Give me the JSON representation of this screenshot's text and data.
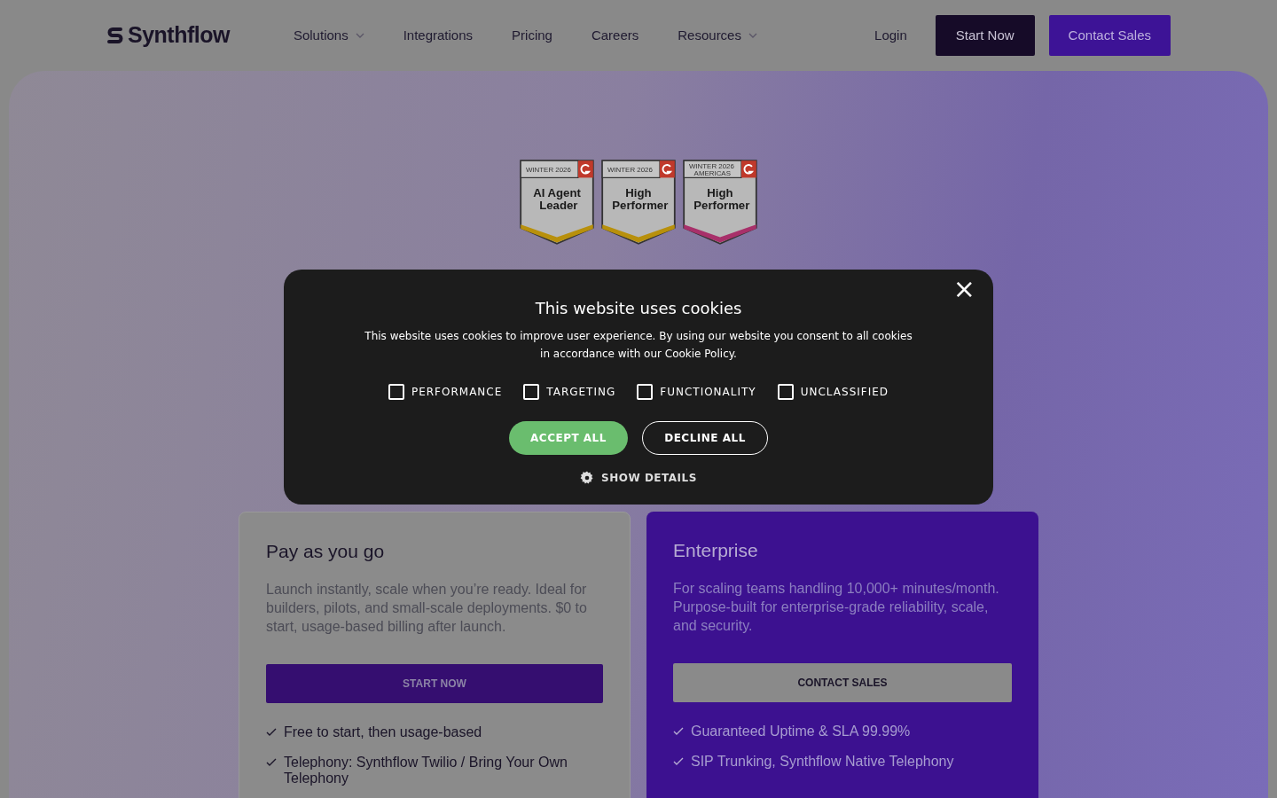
{
  "nav": {
    "logo": "Synthflow",
    "links": [
      {
        "label": "Solutions",
        "dropdown": true
      },
      {
        "label": "Integrations",
        "dropdown": false
      },
      {
        "label": "Pricing",
        "dropdown": false
      },
      {
        "label": "Careers",
        "dropdown": false
      },
      {
        "label": "Resources",
        "dropdown": true
      }
    ],
    "login": "Login",
    "start": "Start Now",
    "contact": "Contact Sales"
  },
  "badges": [
    {
      "season": "WINTER 2026",
      "title": "AI Agent Leader",
      "color": "#b8900c"
    },
    {
      "season": "WINTER 2026",
      "title": "High Performer",
      "color": "#b8900c"
    },
    {
      "season": "WINTER 2026 AMERICAS",
      "title": "High Performer",
      "color": "#a8306a"
    }
  ],
  "cookie_banner": {
    "title": "This website uses cookies",
    "text": "This website uses cookies to improve user experience. By using our website you consent to all cookies in accordance with our Cookie Policy.",
    "close": "×",
    "options": [
      {
        "label": "PERFORMANCE",
        "checked": false
      },
      {
        "label": "TARGETING",
        "checked": false
      },
      {
        "label": "FUNCTIONALITY",
        "checked": false
      },
      {
        "label": "UNCLASSIFIED",
        "checked": false
      }
    ],
    "accept": "ACCEPT ALL",
    "decline": "DECLINE ALL",
    "details": "SHOW DETAILS"
  },
  "plans": [
    {
      "kind": "light",
      "title": "Pay as you go",
      "description": "Launch instantly, scale when you’re ready. Ideal for builders, pilots, and small-scale deployments. $0 to start, usage-based billing after launch.",
      "button": "START NOW",
      "features": [
        "Free to start, then usage-based",
        "Telephony: Synthflow Twilio / Bring Your Own Telephony"
      ]
    },
    {
      "kind": "dark",
      "title": "Enterprise",
      "description": "For scaling teams handling 10,000+ minutes/month. Purpose-built for enterprise-grade reliability, scale, and security.",
      "button": "CONTACT SALES",
      "features": [
        "Guaranteed Uptime & SLA 99.99%",
        "SIP Trunking, Synthflow Native Telephony"
      ]
    }
  ]
}
